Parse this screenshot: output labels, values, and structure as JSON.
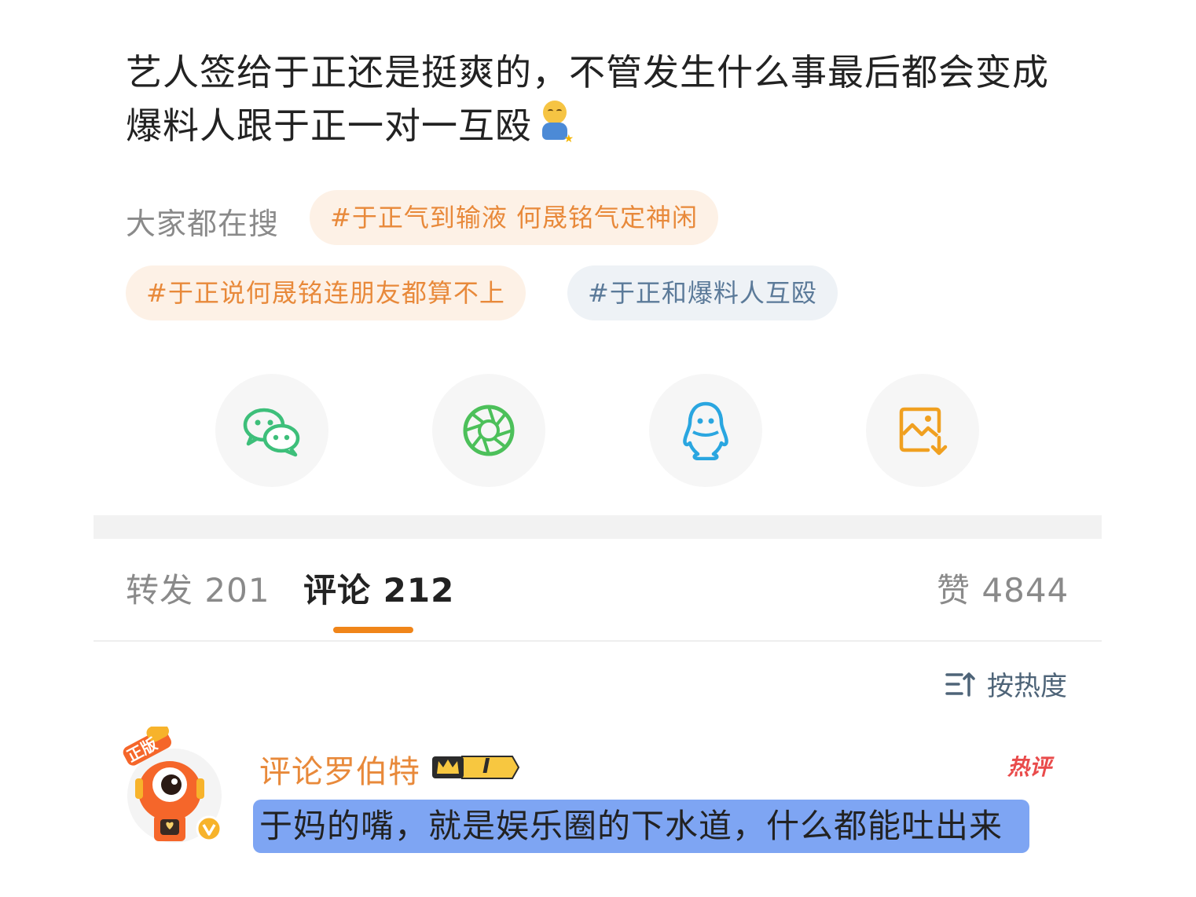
{
  "post": {
    "line1": "艺人签给于正还是挺爽的，不管发生什么事最后都会变成",
    "line2": "爆料人跟于正一对一互殴"
  },
  "hot_search": {
    "label": "大家都在搜",
    "tags": [
      {
        "text": "#于正气到输液 何晟铭气定神闲",
        "tone": "orange"
      },
      {
        "text": "#于正说何晟铭连朋友都算不上",
        "tone": "orange"
      },
      {
        "text": "#于正和爆料人互殴",
        "tone": "blue"
      }
    ]
  },
  "share": {
    "icons": [
      "wechat-icon",
      "moments-icon",
      "qq-icon",
      "save-image-icon"
    ],
    "colors": {
      "wechat": "#3dbf7a",
      "moments": "#4cc05a",
      "qq": "#2aa6e0",
      "save": "#f0a020"
    }
  },
  "tabs": {
    "repost_label": "转发",
    "repost_count": "201",
    "comment_label": "评论",
    "comment_count": "212",
    "like_label": "赞",
    "like_count": "4844"
  },
  "sort": {
    "label": "按热度"
  },
  "comment": {
    "username": "评论罗伯特",
    "level": "I",
    "avatar_tag": "正版",
    "hot_label": "热评",
    "text": "于妈的嘴，就是娱乐圈的下水道，什么都能吐出来"
  },
  "colors": {
    "accent": "#f08519",
    "tag_orange": "#e8893a",
    "tag_blue": "#5b7a99",
    "highlight": "#7ea5f3"
  }
}
